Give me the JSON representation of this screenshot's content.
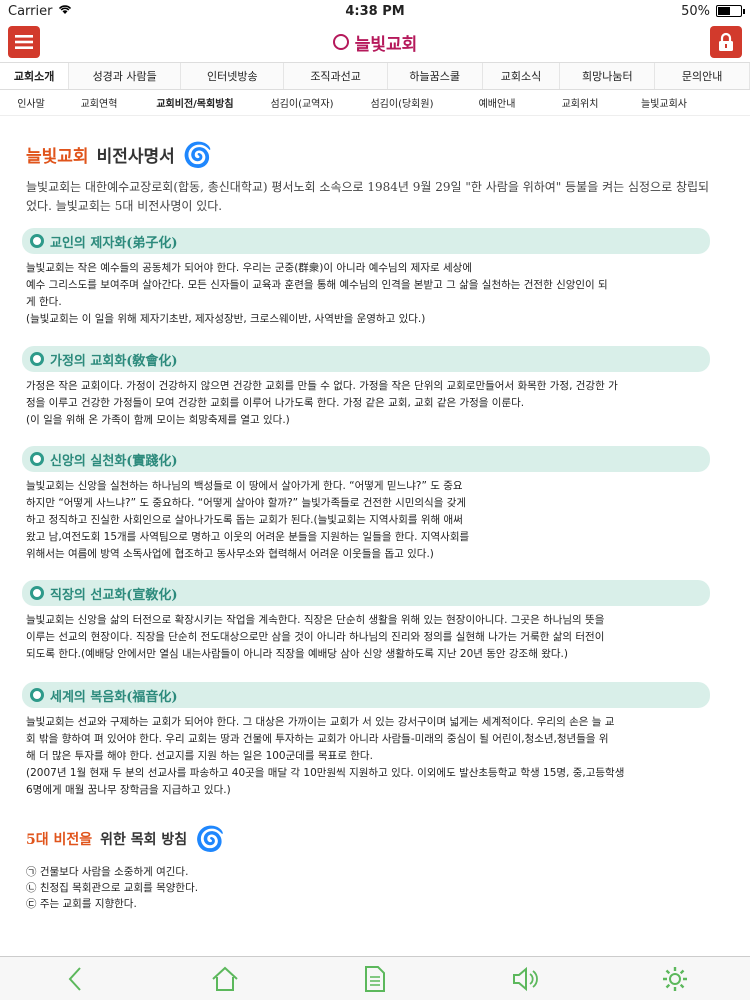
{
  "status": {
    "carrier": "Carrier",
    "time": "4:38 PM",
    "battery": "50%",
    "battery_level": 0.5
  },
  "app": {
    "logo": "늘빛교회"
  },
  "nav": {
    "main": [
      "교회소개",
      "성경과 사람들",
      "인터넷방송",
      "조직과선교",
      "하늘꿈스쿨",
      "교회소식",
      "희망나눔터",
      "문의안내"
    ],
    "sub": [
      "인사말",
      "교회연혁",
      "교회비전/목회방침",
      "섬김이(교역자)",
      "섬김이(당회원)",
      "예배안내",
      "교회위치",
      "늘빛교회사"
    ]
  },
  "page": {
    "title_red": "늘빛교회",
    "title_dark": "비전사명서",
    "intro": "늘빛교회는 대한예수교장로회(합동, 총신대학교) 평서노회 소속으로 1984년 9월 29일  \"한 사람을 위하여\"  등불을 켜는 심정으로 창립되었다.  늘빛교회는 5대 비전사명이 있다.",
    "sections": [
      {
        "title": "교인의 제자화(弟子化)",
        "lines": [
          "늘빛교회는 작은 예수들의 공동체가 되어야 한다. 우리는 군중(群衆)이 아니라 예수님의 제자로 세상에",
          "예수 그리스도를 보여주며 살아간다. 모든 신자들이 교육과 훈련을 통해 예수님의 인격을 본받고 그 삶을 실천하는 건전한 신앙인이 되",
          "게 한다.",
          "(늘빛교회는 이 일을 위해 제자기초반, 제자성장반, 크로스웨이반, 사역반을 운영하고 있다.)"
        ]
      },
      {
        "title": "가정의 교회화(敎會化)",
        "lines": [
          "가정은 작은 교회이다. 가정이 건강하지 않으면 건강한 교회를 만들 수 없다. 가정을 작은 단위의 교회로만들어서 화목한 가정, 건강한 가",
          "정을 이루고 건강한 가정들이 모여 건강한 교회를 이루어 나가도록 한다. 가정 같은 교회, 교회 같은 가정을 이룬다.",
          "(이 일을 위해 온 가족이 함께 모이는 희망축제를 열고 있다.)"
        ]
      },
      {
        "title": "신앙의 실천화(實踐化)",
        "lines": [
          "늘빛교회는 신앙을 실천하는 하나님의 백성들로 이 땅에서 살아가게 한다. “어떻게 믿느냐?” 도 중요",
          "하지만 “어떻게 사느냐?” 도 중요하다. “어떻게 살아야 할까?” 늘빛가족들로 건전한 시민의식을 갖게",
          "하고 정직하고 진실한 사회인으로 살아나가도록 돕는 교회가 된다.(늘빛교회는 지역사회를 위해 애써",
          "왔고 남,여전도회 15개를 사역팀으로 명하고 이웃의 어려운 분들을 지원하는 일들을 한다. 지역사회를",
          "위해서는 여름에 방역 소독사업에 협조하고 동사무소와 협력해서 어려운 이웃들을 돕고 있다.)"
        ]
      },
      {
        "title": "직장의 선교화(宣敎化)",
        "lines": [
          "늘빛교회는 신앙을 삶의 터전으로 확장시키는 작업을 계속한다. 직장은 단순히 생활을 위해 있는 현장이아니다. 그곳은 하나님의 뜻을",
          "이루는 선교의 현장이다. 직장을 단순히 전도대상으로만 삼을 것이 아니라 하나님의 진리와 정의를 실현해 나가는 거룩한 삶의 터전이",
          "되도록 한다.(예배당 안에서만 열심 내는사람들이 아니라 직장을 예배당 삼아 신앙 생활하도록 지난 20년 동안 강조해 왔다.)"
        ]
      },
      {
        "title": "세계의 복음화(福音化)",
        "lines": [
          "늘빛교회는 선교와 구제하는 교회가 되어야 한다. 그 대상은 가까이는 교회가 서 있는 강서구이며 넓게는 세계적이다. 우리의 손은 늘 교",
          "회 밖을 향하여 펴 있어야 한다. 우리 교회는 땅과 건물에 투자하는 교회가 아니라 사람들-미래의 중심이 될 어린이,청소년,청년들을 위",
          "해 더 많은 투자를 해야 한다. 선교지를 지원 하는 일은 100군데를 목표로 한다.",
          "(2007년 1월 현재 두 분의 선교사를 파송하고 40곳을 매달 각 10만원씩 지원하고 있다. 이외에도 발산초등학교 학생 15명, 중,고등학생",
          "6명에게 매월 꿈나무 장학금을 지급하고 있다.)"
        ]
      }
    ],
    "policy_title_red": "5대 비전을",
    "policy_title_dark": "위한 목회 방침",
    "policies": [
      "㉠ 건물보다 사람을 소중하게 여긴다.",
      "㉡ 친정집 목회관으로 교회를 목양한다.",
      "㉢ 주는 교회를 지향한다."
    ]
  },
  "toolbar": [
    "back-icon",
    "home-icon",
    "document-icon",
    "speaker-icon",
    "gear-icon"
  ],
  "colors": {
    "accent_red": "#d23a2c",
    "logo": "#b5195b",
    "section_bg": "#d9efe9",
    "section_text": "#2c8a7c",
    "title_orange": "#e0541b",
    "toolbar_icon": "#5cb85c"
  }
}
